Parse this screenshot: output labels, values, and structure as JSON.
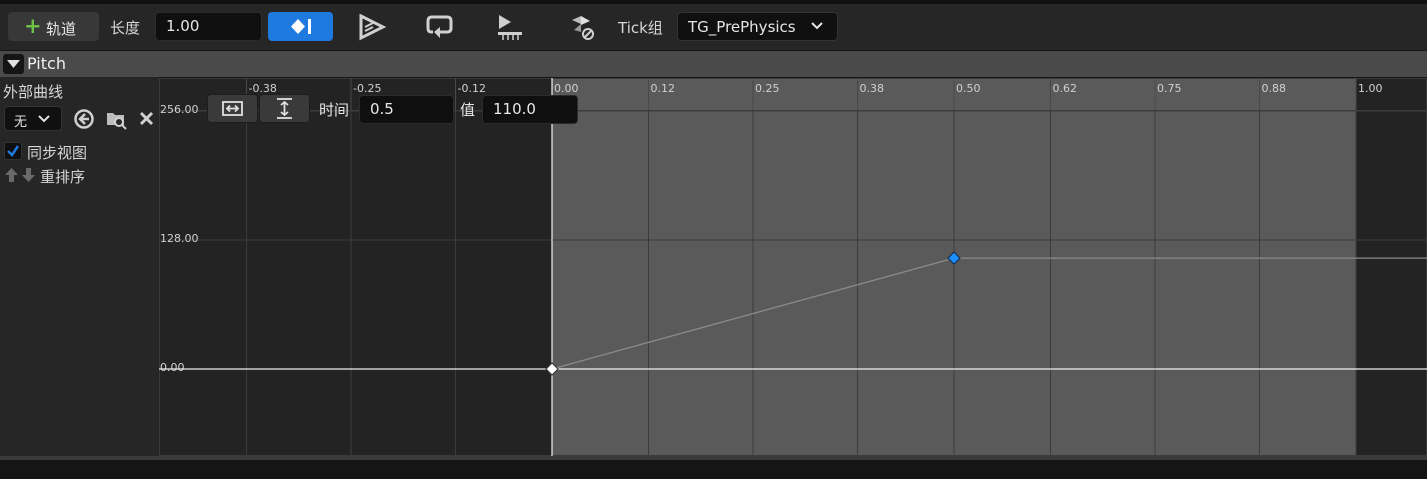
{
  "toolbar": {
    "add_track_label": "轨道",
    "length_label": "长度",
    "length_value": "1.00",
    "tick_group_label": "Tick组",
    "tick_group_value": "TG_PrePhysics",
    "icons": [
      "plus-icon",
      "add-key-icon",
      "autoplay-icon",
      "loop-icon",
      "use-last-keyframe-icon",
      "ignore-time-dilation-icon",
      "chevron-down-icon"
    ]
  },
  "track": {
    "name": "Pitch"
  },
  "left_panel": {
    "external_curve_label": "外部曲线",
    "external_curve_value": "无",
    "sync_view_label": "同步视图",
    "sync_view_checked": true,
    "reorder_label": "重排序"
  },
  "key_editor": {
    "time_label": "时间",
    "time_value": "0.5",
    "value_label": "值",
    "value_value": "110.0"
  },
  "curve": {
    "x_ticks": [
      "-0.38",
      "-0.25",
      "-0.12",
      "0.00",
      "0.12",
      "0.25",
      "0.38",
      "0.50",
      "0.62",
      "0.75",
      "0.88",
      "1.00"
    ],
    "y_ticks": [
      "256.00",
      "128.00",
      "0.00"
    ],
    "keys": [
      {
        "time": 0.0,
        "value": 0.0
      },
      {
        "time": 0.5,
        "value": 110.0
      }
    ],
    "colors": {
      "key_selected": "#1e90ff",
      "key": "#ffffff",
      "active_range_bg": "#5a5a5a",
      "inactive_bg": "#232323",
      "accent": "#1f7ae0"
    }
  }
}
